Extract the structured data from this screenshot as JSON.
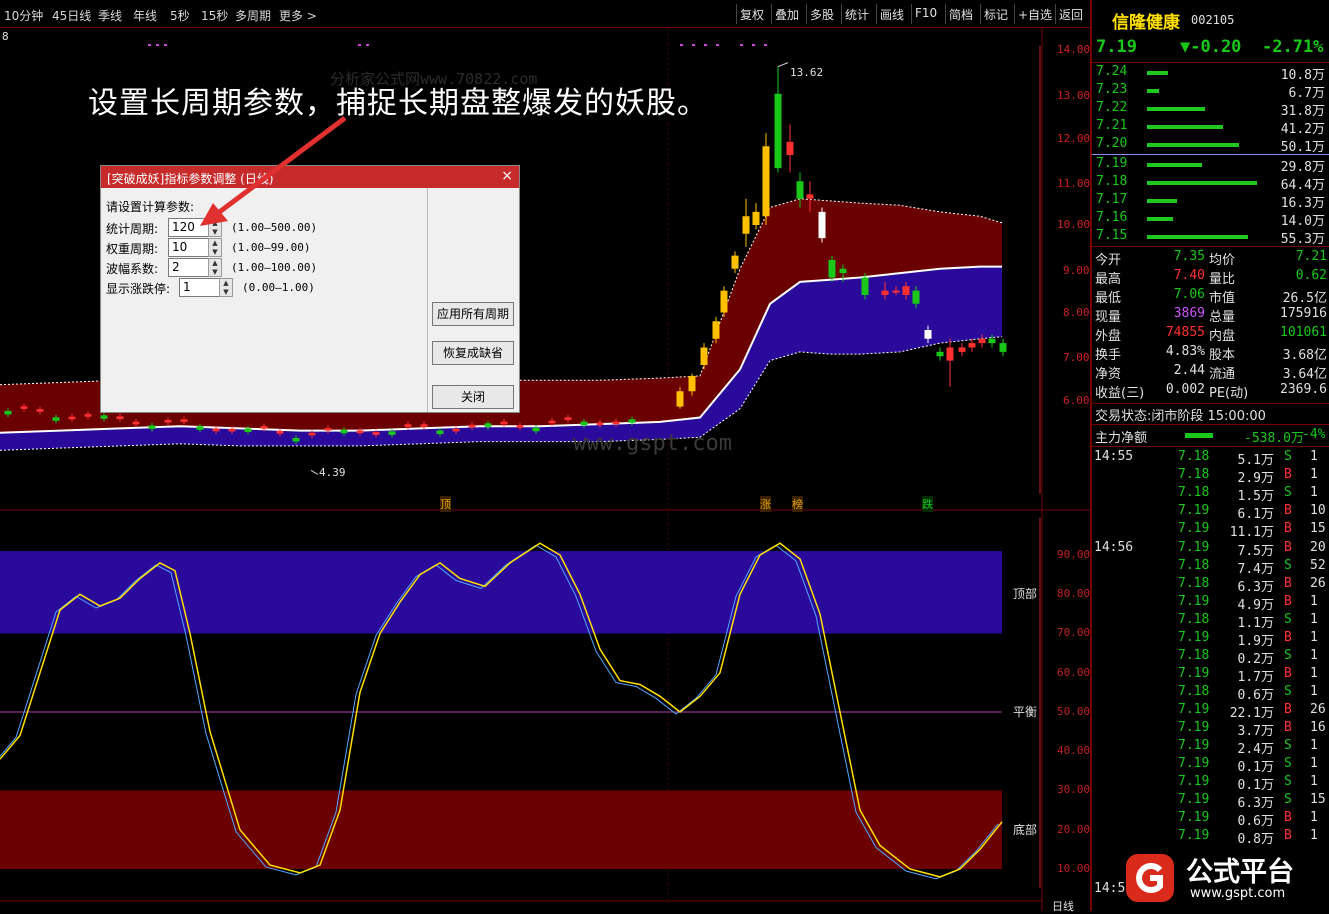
{
  "toolbar": {
    "left": [
      "10分钟",
      "45日线",
      "季线",
      "年线",
      "5秒",
      "15秒",
      "多周期",
      "更多 >"
    ],
    "right": [
      "复权",
      "叠加",
      "多股",
      "统计",
      "画线",
      "F10",
      "简档",
      "标记",
      "+自选",
      "返回"
    ]
  },
  "chart_row_marker": "8",
  "headline": "设置长周期参数，捕捉长期盘整爆发的妖股。",
  "watermarks": {
    "repeated": "分析家公式网www.70822.com",
    "site": "www.gspt.com"
  },
  "price_axis": [
    "14.00",
    "13.00",
    "12.00",
    "11.00",
    "10.00",
    "9.00",
    "8.00",
    "7.00",
    "6.00"
  ],
  "price_annotations": {
    "high": "13.62",
    "low": "4.39"
  },
  "markers": [
    "顶",
    "涨",
    "榜",
    "跌"
  ],
  "indicator_axis": [
    "90.00",
    "80.00",
    "70.00",
    "60.00",
    "50.00",
    "40.00",
    "30.00",
    "20.00",
    "10.00"
  ],
  "indicator_bands": {
    "top": "顶部",
    "mid": "平衡",
    "bottom": "底部"
  },
  "bottom_axis": {
    "label": "日线"
  },
  "dialog": {
    "title": "[突破成妖]指标参数调整 (日线)",
    "close": "×",
    "prompt": "请设置计算参数:",
    "params": [
      {
        "label": "统计周期:",
        "value": "120",
        "range": "(1.00—500.00)"
      },
      {
        "label": "权重周期:",
        "value": "10",
        "range": "(1.00—99.00)"
      },
      {
        "label": "波幅系数:",
        "value": "2",
        "range": "(1.00—100.00)"
      },
      {
        "label": "显示涨跌停:",
        "value": "1",
        "range": "(0.00—1.00)"
      }
    ],
    "buttons": [
      "应用所有周期",
      "恢复成缺省",
      "关闭"
    ]
  },
  "quote": {
    "name": "信隆健康",
    "code": "002105",
    "price": "7.19",
    "change": "▼-0.20",
    "pct": "-2.71%",
    "asks": [
      {
        "p": "7.24",
        "v": "10.8万",
        "len": 0.19
      },
      {
        "p": "7.23",
        "v": "6.7万",
        "len": 0.11
      },
      {
        "p": "7.22",
        "v": "31.8万",
        "len": 0.53
      },
      {
        "p": "7.21",
        "v": "41.2万",
        "len": 0.69
      },
      {
        "p": "7.20",
        "v": "50.1万",
        "len": 0.84
      }
    ],
    "bids": [
      {
        "p": "7.19",
        "v": "29.8万",
        "len": 0.5
      },
      {
        "p": "7.18",
        "v": "64.4万",
        "len": 1.0
      },
      {
        "p": "7.17",
        "v": "16.3万",
        "len": 0.27
      },
      {
        "p": "7.16",
        "v": "14.0万",
        "len": 0.24
      },
      {
        "p": "7.15",
        "v": "55.3万",
        "len": 0.92
      }
    ],
    "stats": [
      [
        "今开",
        "7.35",
        "均价",
        "7.21"
      ],
      [
        "最高",
        "7.40",
        "量比",
        "0.62"
      ],
      [
        "最低",
        "7.06",
        "市值",
        "26.5亿"
      ],
      [
        "现量",
        "3869",
        "总量",
        "175916"
      ],
      [
        "外盘",
        "74855",
        "内盘",
        "101061"
      ],
      [
        "换手",
        "4.83%",
        "股本",
        "3.68亿"
      ],
      [
        "净资",
        "2.44",
        "流通",
        "3.64亿"
      ],
      [
        "收益(三)",
        "0.002",
        "PE(动)",
        "2369.6"
      ]
    ],
    "status": "交易状态:闭市阶段 15:00:00",
    "fund_label": "主力净额",
    "fund_value": "-538.0万",
    "fund_pct": "-4%",
    "ticks": [
      {
        "t": "14:55",
        "p": "7.18",
        "v": "5.1万",
        "s": "S",
        "n": "1"
      },
      {
        "t": "",
        "p": "7.18",
        "v": "2.9万",
        "s": "B",
        "n": "1"
      },
      {
        "t": "",
        "p": "7.18",
        "v": "1.5万",
        "s": "S",
        "n": "1"
      },
      {
        "t": "",
        "p": "7.19",
        "v": "6.1万",
        "s": "B",
        "n": "10"
      },
      {
        "t": "",
        "p": "7.19",
        "v": "11.1万",
        "s": "B",
        "n": "15"
      },
      {
        "t": "14:56",
        "p": "7.19",
        "v": "7.5万",
        "s": "B",
        "n": "20"
      },
      {
        "t": "",
        "p": "7.18",
        "v": "7.4万",
        "s": "S",
        "n": "52"
      },
      {
        "t": "",
        "p": "7.18",
        "v": "6.3万",
        "s": "B",
        "n": "26"
      },
      {
        "t": "",
        "p": "7.19",
        "v": "4.9万",
        "s": "B",
        "n": "1"
      },
      {
        "t": "",
        "p": "7.18",
        "v": "1.1万",
        "s": "S",
        "n": "1"
      },
      {
        "t": "",
        "p": "7.19",
        "v": "1.9万",
        "s": "B",
        "n": "1"
      },
      {
        "t": "",
        "p": "7.18",
        "v": "0.2万",
        "s": "S",
        "n": "1"
      },
      {
        "t": "",
        "p": "7.19",
        "v": "1.7万",
        "s": "B",
        "n": "1"
      },
      {
        "t": "",
        "p": "7.18",
        "v": "0.6万",
        "s": "S",
        "n": "1"
      },
      {
        "t": "",
        "p": "7.19",
        "v": "22.1万",
        "s": "B",
        "n": "26"
      },
      {
        "t": "",
        "p": "7.19",
        "v": "3.7万",
        "s": "B",
        "n": "16"
      },
      {
        "t": "",
        "p": "7.19",
        "v": "2.4万",
        "s": "S",
        "n": "1"
      },
      {
        "t": "",
        "p": "7.19",
        "v": "0.1万",
        "s": "S",
        "n": "1"
      },
      {
        "t": "",
        "p": "7.19",
        "v": "0.1万",
        "s": "S",
        "n": "1"
      },
      {
        "t": "",
        "p": "7.19",
        "v": "6.3万",
        "s": "S",
        "n": "15"
      },
      {
        "t": "",
        "p": "7.19",
        "v": "0.6万",
        "s": "B",
        "n": "1"
      },
      {
        "t": "",
        "p": "7.19",
        "v": "0.8万",
        "s": "B",
        "n": "1"
      }
    ],
    "last_time": "14:5"
  },
  "logo": {
    "text": "公式平台",
    "url": "www.gspt.com"
  },
  "colors": {
    "up": "#ff3030",
    "down": "#19c819",
    "band_purple": "#2a0a9a",
    "band_red": "#6a0000",
    "yellow": "#ffe000"
  }
}
